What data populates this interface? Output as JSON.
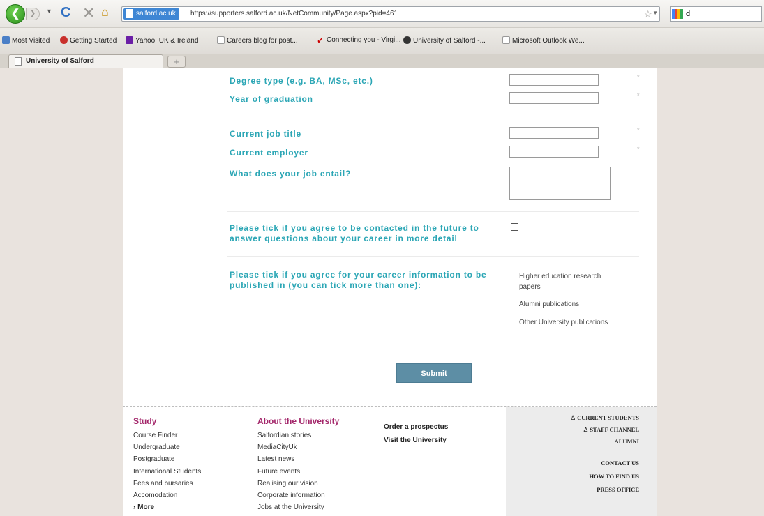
{
  "browser": {
    "url_identity": "salford.ac.uk",
    "url": "https://supporters.salford.ac.uk/NetCommunity/Page.aspx?pid=461",
    "search_value": "d",
    "bookmarks": [
      "Most Visited",
      "Getting Started",
      "Yahoo! UK & Ireland",
      "Careers blog for post...",
      "Connecting you - Virgi...",
      "University of Salford -...",
      "Microsoft Outlook We..."
    ],
    "tab_title": "University of Salford",
    "newtab": "+"
  },
  "form": {
    "degree_label": "Degree type (e.g. BA, MSc, etc.)",
    "year_label": "Year of graduation",
    "job_title_label": "Current job title",
    "employer_label": "Current employer",
    "job_entail_label": "What does your job entail?",
    "contact_label": "Please tick if you agree to be contacted in the future to answer questions about your career in more detail",
    "publish_label": "Please tick if you agree for your career information to be published in (you can tick more than one):",
    "options": [
      "Higher education research papers",
      "Alumni publications",
      "Other University publications"
    ],
    "required_mark": "*",
    "submit": "Submit"
  },
  "footer": {
    "study_heading": "Study",
    "study_links": [
      "Course Finder",
      "Undergraduate",
      "Postgraduate",
      "International Students",
      "Fees and bursaries",
      "Accomodation"
    ],
    "study_more": "More",
    "about_heading": "About the University",
    "about_links": [
      "Salfordian stories",
      "MediaCityUk",
      "Latest news",
      "Future events",
      "Realising our vision",
      "Corporate information",
      "Jobs at the University"
    ],
    "quick_links": [
      "Order a prospectus",
      "Visit the University"
    ],
    "right_links_1": [
      "CURRENT STUDENTS",
      "STAFF CHANNEL",
      "ALUMNI"
    ],
    "right_links_2": [
      "CONTACT US",
      "HOW TO FIND US",
      "PRESS OFFICE"
    ]
  },
  "colors": {
    "label": "#2ba6b5",
    "footer_heading": "#a3266a",
    "button": "#5d8ea5"
  }
}
